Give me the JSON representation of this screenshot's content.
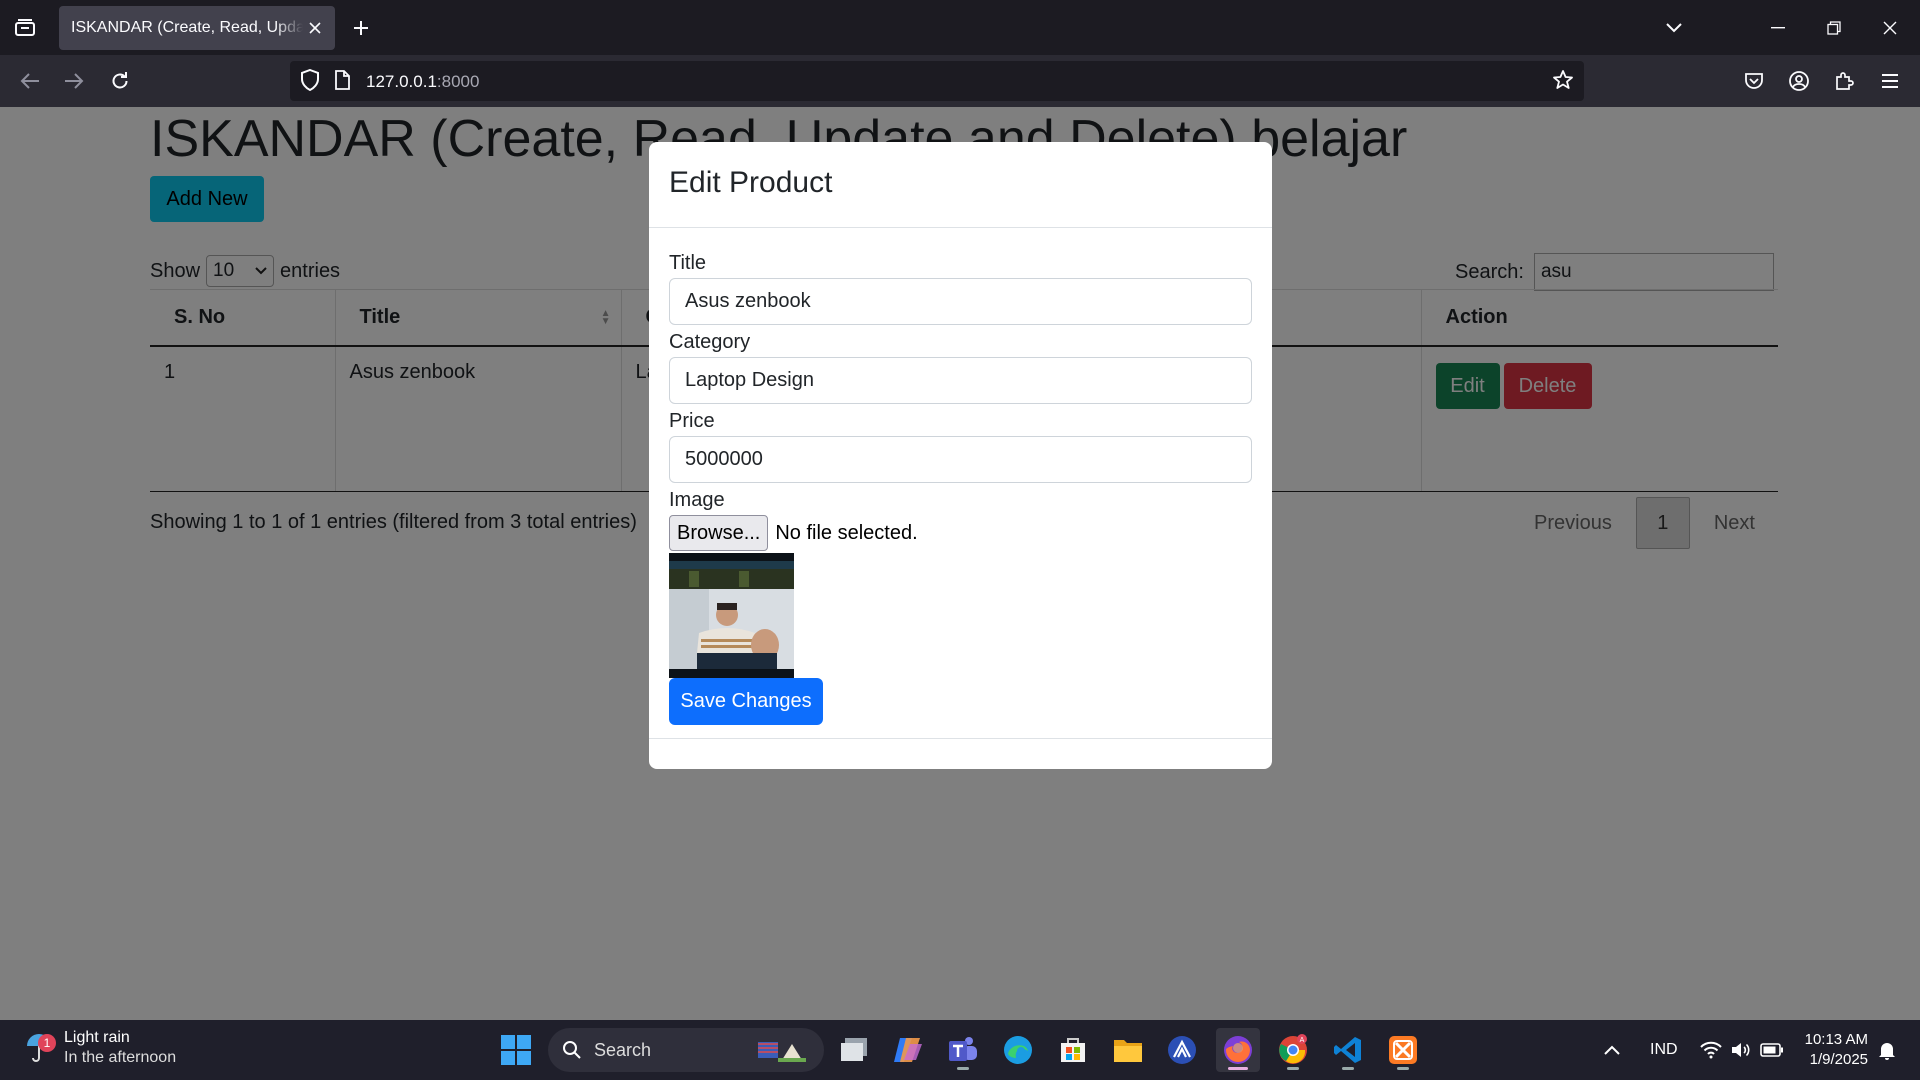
{
  "browser": {
    "tab_title": "ISKANDAR (Create, Read, Update and Delete) belajar",
    "url_host": "127.0.0.1",
    "url_port": ":8000"
  },
  "page": {
    "heading": "ISKANDAR (Create, Read, Update and Delete) belajar",
    "add_new_label": "Add New",
    "show_label": "Show",
    "entries_label": "entries",
    "page_length": "10",
    "search_label": "Search:",
    "search_value": "asu",
    "columns": [
      "S. No",
      "Title",
      "Category",
      "Action"
    ],
    "rows": [
      {
        "sno": "1",
        "title": "Asus zenbook",
        "category": "Laptop Design"
      }
    ],
    "edit_label": "Edit",
    "delete_label": "Delete",
    "info": "Showing 1 to 1 of 1 entries (filtered from 3 total entries)",
    "pagination": {
      "previous": "Previous",
      "current": "1",
      "next": "Next"
    }
  },
  "modal": {
    "title": "Edit Product",
    "title_label": "Title",
    "title_value": "Asus zenbook",
    "category_label": "Category",
    "category_value": "Laptop Design",
    "price_label": "Price",
    "price_value": "5000000",
    "image_label": "Image",
    "browse_label": "Browse...",
    "file_status": "No file selected.",
    "save_label": "Save Changes"
  },
  "taskbar": {
    "weather_title": "Light rain",
    "weather_sub": "In the afternoon",
    "weather_badge": "1",
    "search_label": "Search",
    "language": "IND",
    "time": "10:13 AM",
    "date": "1/9/2025",
    "apps": [
      "task-view",
      "copilot",
      "teams",
      "edge",
      "microsoft-store",
      "file-explorer",
      "dev-app",
      "firefox",
      "chrome",
      "vscode",
      "xampp"
    ]
  },
  "colors": {
    "add_new": "#0dcaf0",
    "edit": "#198754",
    "delete": "#dc3545",
    "save": "#0d6efd"
  }
}
